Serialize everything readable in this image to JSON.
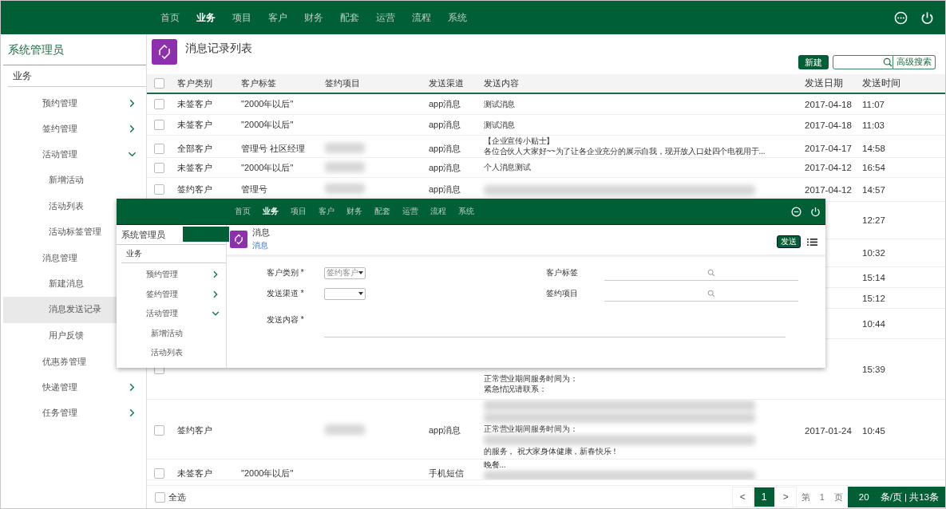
{
  "nav": {
    "items": [
      {
        "label": "首页",
        "selected": false
      },
      {
        "label": "业务",
        "selected": true
      },
      {
        "label": "项目",
        "selected": false
      },
      {
        "label": "客户",
        "selected": false
      },
      {
        "label": "财务",
        "selected": false
      },
      {
        "label": "配套",
        "selected": false
      },
      {
        "label": "运营",
        "selected": false
      },
      {
        "label": "流程",
        "selected": false
      },
      {
        "label": "系统",
        "selected": false
      }
    ]
  },
  "sidebar": {
    "user": "系统管理员",
    "section": "业务",
    "items": [
      {
        "label": "预约管理",
        "selected": false,
        "expanded": false
      },
      {
        "label": "签约管理",
        "selected": false,
        "expanded": false
      },
      {
        "label": "活动管理",
        "selected": false,
        "expanded": true,
        "children": [
          {
            "label": "新增活动",
            "selected": false
          },
          {
            "label": "活动列表",
            "selected": false
          },
          {
            "label": "活动标签管理",
            "selected": false
          }
        ]
      },
      {
        "label": "消息管理",
        "selected": false,
        "children": [
          {
            "label": "新建消息",
            "selected": false
          },
          {
            "label": "消息发送记录",
            "selected": true
          },
          {
            "label": "用户反馈",
            "selected": false
          }
        ]
      },
      {
        "label": "优惠券管理",
        "selected": false
      },
      {
        "label": "快递管理",
        "selected": false,
        "expanded": false
      },
      {
        "label": "任务管理",
        "selected": false,
        "expanded": false
      }
    ]
  },
  "page": {
    "title": "消息记录列表",
    "new_button": "新建",
    "advanced_button": "高级搜索"
  },
  "table": {
    "header_checked": false,
    "columns": [
      "客户类别",
      "客户标签",
      "签约项目",
      "发送渠道",
      "发送内容",
      "发送日期",
      "发送时间"
    ],
    "rows": [
      {
        "checked": false,
        "category": "未签客户",
        "tag": "\"2000年以后\"",
        "channel": "app消息",
        "content": [
          {
            "kind": "text",
            "text": "测试消息"
          }
        ],
        "date": "2017-04-18",
        "time": "11:07"
      },
      {
        "checked": false,
        "category": "未签客户",
        "tag": "\"2000年以后\"",
        "channel": "app消息",
        "content": [
          {
            "kind": "text",
            "text": "测试消息"
          }
        ],
        "date": "2017-04-18",
        "time": "11:03"
      },
      {
        "checked": false,
        "category": "全部客户",
        "tag": "管理号 社区经理",
        "project_blurred": true,
        "channel": "app消息",
        "content": [
          {
            "kind": "text",
            "text": "【企业宣传小贴士】"
          },
          {
            "kind": "text",
            "text": "各位合伙人大家好~~为了让各企业充分的展示自我，现开放入口处四个电视用于..."
          }
        ],
        "date": "2017-04-17",
        "time": "14:58"
      },
      {
        "checked": false,
        "category": "未签客户",
        "tag": "\"2000年以后\"",
        "project_blurred": true,
        "channel": "app消息",
        "content": [
          {
            "kind": "text",
            "text": "个人消息测试"
          }
        ],
        "date": "2017-04-12",
        "time": "16:54"
      },
      {
        "checked": false,
        "category": "签约客户",
        "tag": "管理号",
        "project_blurred": true,
        "channel": "app消息",
        "content": [
          {
            "kind": "blur"
          }
        ],
        "date": "2017-04-12",
        "time": "14:57"
      },
      {
        "time": "12:27"
      },
      {
        "time": "10:32"
      },
      {
        "time": "15:14"
      },
      {
        "time": "15:12"
      },
      {
        "time": "10:44"
      },
      {
        "checked": false,
        "content": [
          {
            "kind": "text",
            "text": "正常营业期间服务时间为："
          },
          {
            "kind": "text",
            "text": "紧急情况请联系："
          }
        ],
        "time": "15:39"
      },
      {
        "checked": false,
        "category": "签约客户",
        "project_blurred": true,
        "channel": "app消息",
        "content": [
          {
            "kind": "blur"
          },
          {
            "kind": "blur"
          },
          {
            "kind": "text",
            "text": "正常营业期间服务时间为："
          },
          {
            "kind": "blur"
          },
          {
            "kind": "text",
            "text": "的服务， 祝大家身体健康，新春快乐！"
          }
        ],
        "date": "2017-01-24",
        "time": "10:45"
      },
      {
        "checked": false,
        "category": "未签客户",
        "tag": "\"2000年以后\"",
        "channel": "手机短信",
        "content": [
          {
            "kind": "text",
            "text": "晚餐..."
          },
          {
            "kind": "blur"
          }
        ]
      }
    ]
  },
  "footer": {
    "select_all": {
      "label": "全选",
      "checked": false
    },
    "pagination": {
      "prev": "<",
      "pages": [
        {
          "label": "1",
          "selected": true
        }
      ],
      "next": ">",
      "page_prefix": "第",
      "page_no": "1",
      "page_suffix": "页",
      "page_size": "20",
      "size_label": "条/页 | 共13条"
    }
  },
  "overlay": {
    "nav": {
      "items": [
        {
          "label": "首页",
          "selected": false
        },
        {
          "label": "业务",
          "selected": true
        },
        {
          "label": "项目",
          "selected": false
        },
        {
          "label": "客户",
          "selected": false
        },
        {
          "label": "财务",
          "selected": false
        },
        {
          "label": "配套",
          "selected": false
        },
        {
          "label": "运营",
          "selected": false
        },
        {
          "label": "流程",
          "selected": false
        },
        {
          "label": "系统",
          "selected": false
        }
      ]
    },
    "sidebar": {
      "user": "系统管理员",
      "section": "业务",
      "items": [
        {
          "label": "预约管理",
          "expanded": false
        },
        {
          "label": "签约管理",
          "expanded": false
        },
        {
          "label": "活动管理",
          "expanded": true,
          "children": [
            {
              "label": "新增活动"
            },
            {
              "label": "活动列表"
            }
          ]
        }
      ]
    },
    "title": "消息",
    "breadcrumb": "消息",
    "send_button": "发送",
    "fields": [
      {
        "kind": "select",
        "label": "客户类别 *",
        "value": "签约客户"
      },
      {
        "kind": "search",
        "label": "客户标签"
      },
      {
        "kind": "select",
        "label": "发送渠道 *"
      },
      {
        "kind": "search",
        "label": "签约项目"
      },
      {
        "kind": "textarea",
        "label": "发送内容 *"
      }
    ]
  }
}
